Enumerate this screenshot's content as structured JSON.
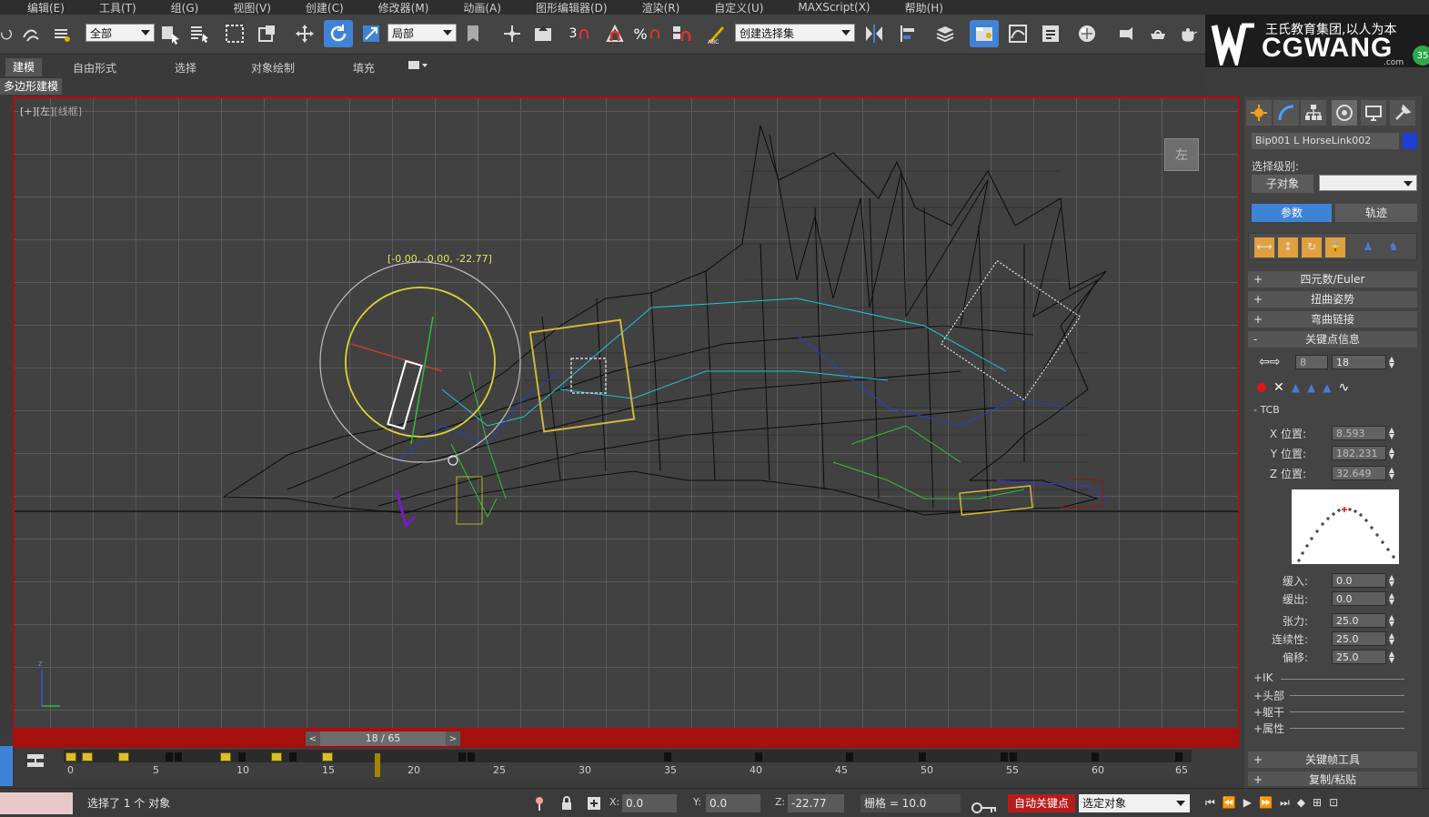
{
  "menubar": [
    "编辑(E)",
    "工具(T)",
    "组(G)",
    "视图(V)",
    "创建(C)",
    "修改器(M)",
    "动画(A)",
    "图形编辑器(D)",
    "渲染(R)",
    "自定义(U)",
    "MAXScript(X)",
    "帮助(H)"
  ],
  "toolbar": {
    "selection_filter": "全部",
    "ref_coord": "局部",
    "named_selection": "创建选择集"
  },
  "logo": {
    "slogan": "王氏教育集团,以人为本",
    "brand": "CGWANG",
    "domain": ".com",
    "badge": "35"
  },
  "ribbon": {
    "tabs": [
      "建模",
      "自由形式",
      "选择",
      "对象绘制",
      "填充"
    ],
    "sub_tab": "多边形建模"
  },
  "viewport": {
    "label_a": "[+]",
    "label_b": "[左]",
    "label_c": "[线框]",
    "coord_tip": "[-0.00, -0.00, -22.77]",
    "viewcube_label": "左"
  },
  "timeslider": {
    "frame": "18 / 65",
    "prev": "<",
    "next": ">"
  },
  "trackbar": {
    "ticks": [
      "0",
      "5",
      "10",
      "15",
      "20",
      "25",
      "30",
      "35",
      "40",
      "45",
      "50",
      "55",
      "60",
      "65"
    ]
  },
  "status": {
    "message": "选择了 1 个 对象",
    "x_label": "X:",
    "x_value": "0.0",
    "y_label": "Y:",
    "y_value": "0.0",
    "z_label": "Z:",
    "z_value": "-22.77",
    "grid": "栅格 = 10.0",
    "autokey": "自动关键点",
    "selected_set": "选定对象"
  },
  "cmdpanel": {
    "object_name": "Bip001 L HorseLink002",
    "selection_level": "选择级别:",
    "sub_object": "子对象",
    "tab_params": "参数",
    "tab_track": "轨迹",
    "rollouts": {
      "quat": "四元数/Euler",
      "twist": "扭曲姿势",
      "bend": "弯曲链接",
      "keyinfo": "关键点信息",
      "keytools": "关键帧工具",
      "copy": "复制/粘贴"
    },
    "key_num": "8",
    "key_frame": "18",
    "tcb": "TCB",
    "x_pos_label": "X 位置:",
    "x_pos": "8.593",
    "y_pos_label": "Y 位置:",
    "y_pos": "182.231",
    "z_pos_label": "Z 位置:",
    "z_pos": "32.649",
    "ease_in_label": "缓入:",
    "ease_in": "0.0",
    "ease_out_label": "缓出:",
    "ease_out": "0.0",
    "tension_label": "张力:",
    "tension": "25.0",
    "continuity_label": "连续性:",
    "continuity": "25.0",
    "bias_label": "偏移:",
    "bias": "25.0",
    "sub_ik": "+IK",
    "sub_head": "+头部",
    "sub_body": "+躯干",
    "sub_props": "+属性"
  }
}
